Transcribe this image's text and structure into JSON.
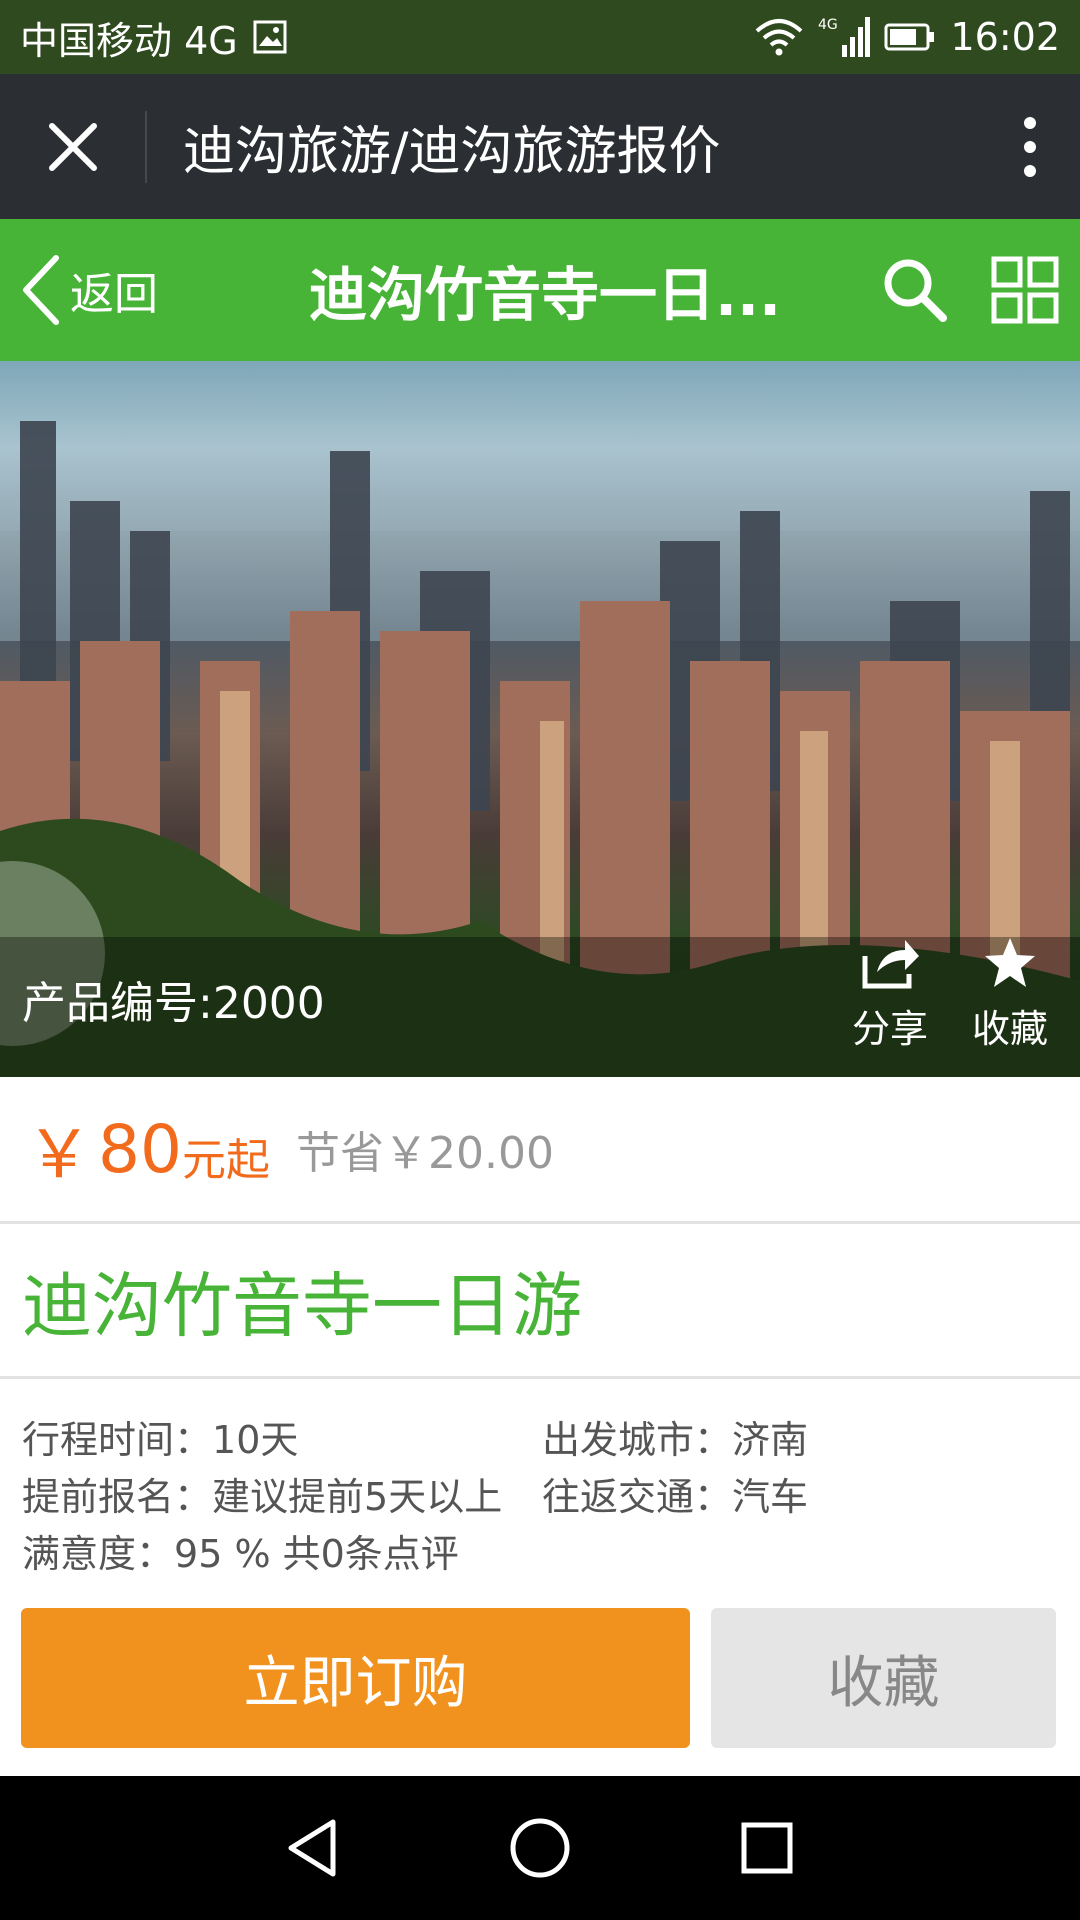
{
  "status_bar": {
    "carrier": "中国移动 4G",
    "network_label": "4G",
    "time": "16:02"
  },
  "wechat_bar": {
    "title": "迪沟旅游/迪沟旅游报价"
  },
  "header": {
    "back_label": "返回",
    "title": "迪沟竹音寺一日...",
    "accent_color": "#47b337"
  },
  "hero": {
    "product_code": "产品编号:2000",
    "share_label": "分享",
    "favorite_label": "收藏"
  },
  "price": {
    "symbol": "￥",
    "value": "80",
    "unit": "元起",
    "savings": "节省￥20.00",
    "color": "#f26b1d"
  },
  "product": {
    "title": "迪沟竹音寺一日游"
  },
  "info": {
    "duration_key": "行程时间：",
    "duration_value": "10天",
    "departure_key": "出发城市：",
    "departure_value": "济南",
    "advance_key": "提前报名：",
    "advance_value": "建议提前5天以上",
    "transport_key": "往返交通：",
    "transport_value": "汽车",
    "satisfaction_key": "满意度：",
    "satisfaction_value": "95 % 共0条点评"
  },
  "actions": {
    "buy_label": "立即订购",
    "favorite_label": "收藏",
    "buy_color": "#f2921e"
  },
  "icons": {
    "close": "close-icon",
    "more": "more-vertical-icon",
    "back": "chevron-left-icon",
    "search": "search-icon",
    "grid": "grid-icon",
    "share": "share-icon",
    "star": "star-icon",
    "nav_back": "nav-back-icon",
    "nav_home": "nav-home-icon",
    "nav_recent": "nav-recent-icon"
  }
}
